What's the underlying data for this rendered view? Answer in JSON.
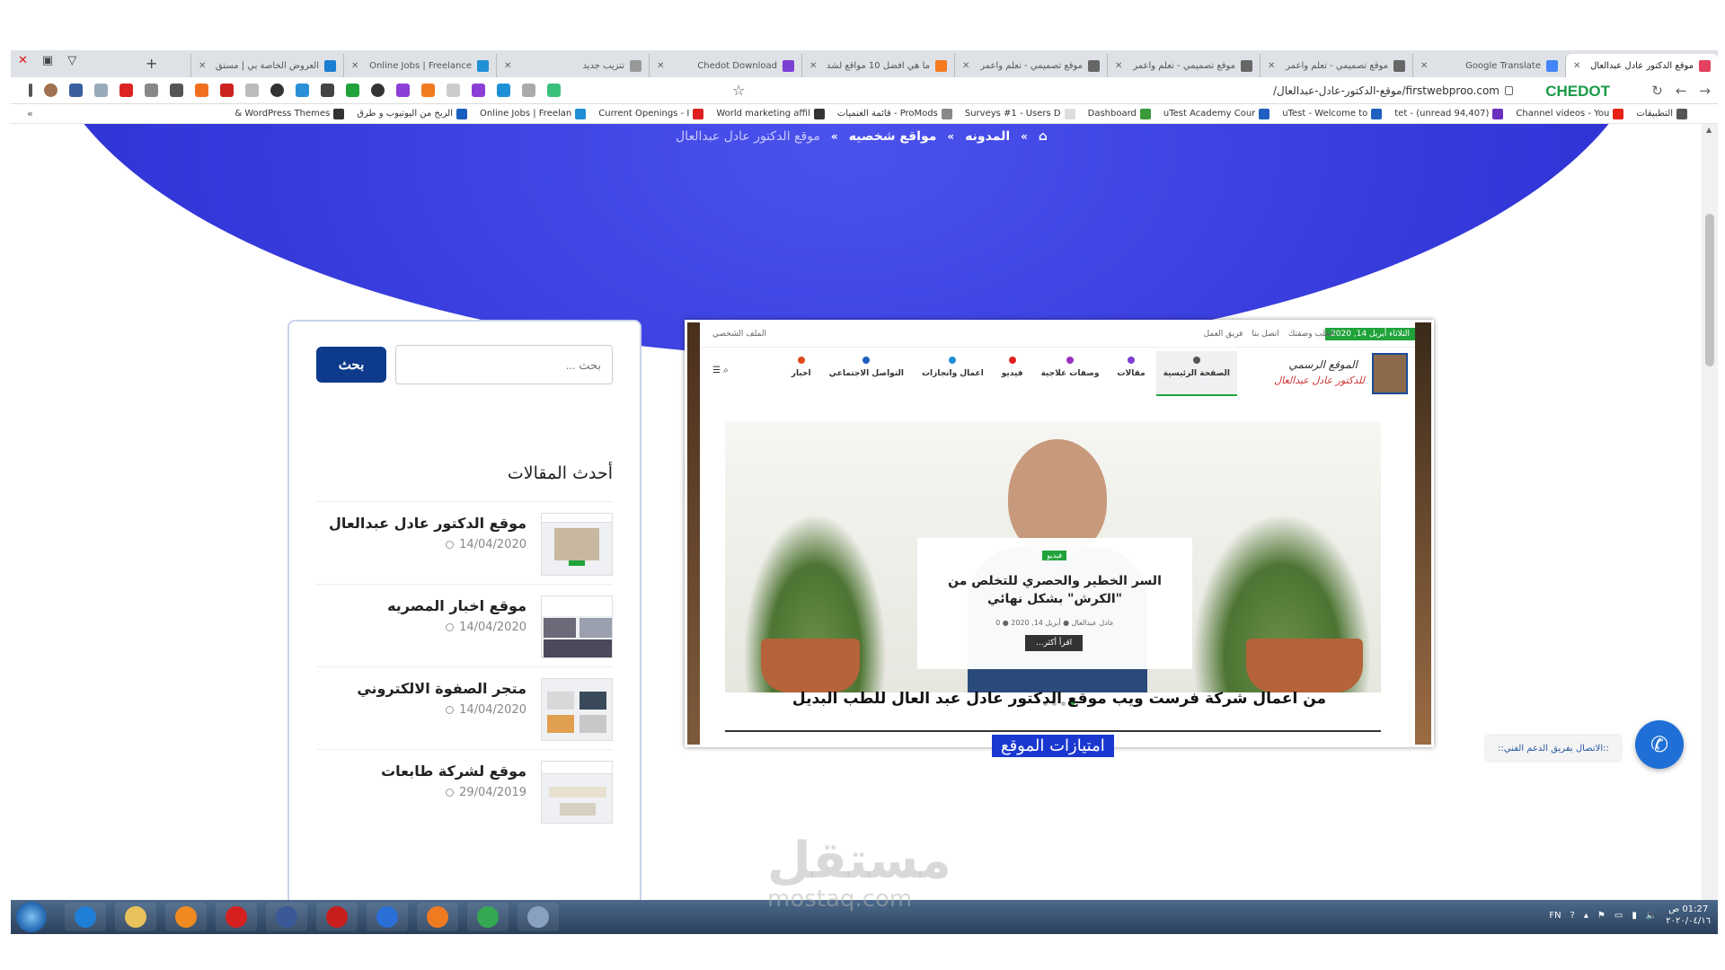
{
  "browser": {
    "brand": "CHEDOT",
    "url": "firstwebproo.com/موقع-الدكتور-عادل-عبدالعال/",
    "tabs": [
      {
        "title": "موقع الدكتور عادل عبدالعال",
        "color": "#e4405f",
        "active": true
      },
      {
        "title": "Google Translate",
        "color": "#4285f4"
      },
      {
        "title": "موقع تصميمي - تعلم واعمر",
        "color": "#666666"
      },
      {
        "title": "موقع تصميمي - تعلم واعمر",
        "color": "#666666"
      },
      {
        "title": "موقع تصميمي - تعلم واعمر",
        "color": "#666666"
      },
      {
        "title": "ما هي افضل 10 مواقع لشد",
        "color": "#f47b20"
      },
      {
        "title": "Chedot Download",
        "color": "#7b3fd6"
      },
      {
        "title": "تنزيب جديد",
        "color": "#999999"
      },
      {
        "title": "Online Jobs | Freelance",
        "color": "#1f8fd6"
      },
      {
        "title": "العروض الخاصة بي | مستق",
        "color": "#1a7fd0"
      }
    ]
  },
  "bookmarks": [
    {
      "label": "التطبيقات",
      "color": "#555555"
    },
    {
      "label": "Channel videos - You",
      "color": "#e62117"
    },
    {
      "label": "(94,407 unread) - tet",
      "color": "#6b2fbf"
    },
    {
      "label": "uTest - Welcome to",
      "color": "#1f5fbf"
    },
    {
      "label": "uTest Academy Cour",
      "color": "#1f5fbf"
    },
    {
      "label": "Dashboard",
      "color": "#3a9a3a"
    },
    {
      "label": "Surveys #1 - Users D",
      "color": "#dddddd"
    },
    {
      "label": "ProMods - قائمة الغنميات",
      "color": "#888888"
    },
    {
      "label": "World marketing affil",
      "color": "#333333"
    },
    {
      "label": "Current Openings - I",
      "color": "#e02020"
    },
    {
      "label": "Online Jobs | Freelan",
      "color": "#1f8fd6"
    },
    {
      "label": "الربح من اليوتيوب و طرق",
      "color": "#1a5fbf"
    },
    {
      "label": "WordPress Themes &",
      "color": "#333333"
    }
  ],
  "breadcrumbs": [
    "الصفحة الرئيسية",
    "المدونه",
    "مواقع شخصيه",
    "موقع الدكتور عادل عبدالعال"
  ],
  "sidebar": {
    "search_button": "بحث",
    "search_placeholder": "بحث ...",
    "latest_title": "أحدث المقالات",
    "posts": [
      {
        "title": "موقع الدكتور عادل عبدالعال",
        "date": "14/04/2020"
      },
      {
        "title": "موقع اخبار المصريه",
        "date": "14/04/2020"
      },
      {
        "title": "متجر الصفوة الالكتروني",
        "date": "14/04/2020"
      },
      {
        "title": "موقع لشركة طابعات",
        "date": "29/04/2019"
      }
    ]
  },
  "preview": {
    "date_badge": "الثلاثاء أبريل 14, 2020",
    "top_links": [
      "اطلب وصفتك",
      "اتصل بنا",
      "فريق العمل"
    ],
    "account": "الملف الشخصي",
    "logo_line1": "الموقع الرسمي",
    "logo_line2": "للدكتور عادل عبدالعال",
    "nav": [
      {
        "label": "الصفحة الرئيسية",
        "color": "#555555"
      },
      {
        "label": "مقالات",
        "color": "#7b3fd6"
      },
      {
        "label": "وصفات علاجية",
        "color": "#9b2fbf"
      },
      {
        "label": "فيديو",
        "color": "#e02020"
      },
      {
        "label": "اعمال وانجازات",
        "color": "#1f8fd6"
      },
      {
        "label": "التواصل الاجتماعي",
        "color": "#1f5fbf"
      },
      {
        "label": "اخبار",
        "color": "#e04a1a"
      }
    ],
    "slide_category": "فيديو",
    "slide_title": "السر الخطير والحصري للتخلص من \"الكرش\" بشكل نهائي",
    "slide_meta": "عادل عبدالعال  ●  أبريل 14, 2020  ●  0",
    "slide_more": "اقرأ أكثر..."
  },
  "caption": "من اعمال شركة فرست ويب موقع الدكتور عادل عبد العال للطب البديل",
  "features_heading": "امتيازات الموقع",
  "support_text": "::الاتصال بفريق الدعم الفني::",
  "watermark": "مستقل",
  "watermark_sub": "mostaq.com",
  "taskbar": {
    "lang": "FN",
    "time": "01:27 ص",
    "date": "٢٠٢٠/٠٤/١٦",
    "apps": [
      {
        "name": "ie-icon",
        "color": "#1f7fd6"
      },
      {
        "name": "folder-icon",
        "color": "#e8c25a"
      },
      {
        "name": "media-player-icon",
        "color": "#f08a20"
      },
      {
        "name": "opera-icon",
        "color": "#d62020"
      },
      {
        "name": "facebook-icon",
        "color": "#3b5998"
      },
      {
        "name": "app-icon",
        "color": "#c81e1e"
      },
      {
        "name": "ccleaner-icon",
        "color": "#2a6fd6"
      },
      {
        "name": "firefox-icon",
        "color": "#f07a20"
      },
      {
        "name": "chrome-icon",
        "color": "#34a853"
      },
      {
        "name": "calculator-icon",
        "color": "#8aa0c0"
      }
    ]
  }
}
